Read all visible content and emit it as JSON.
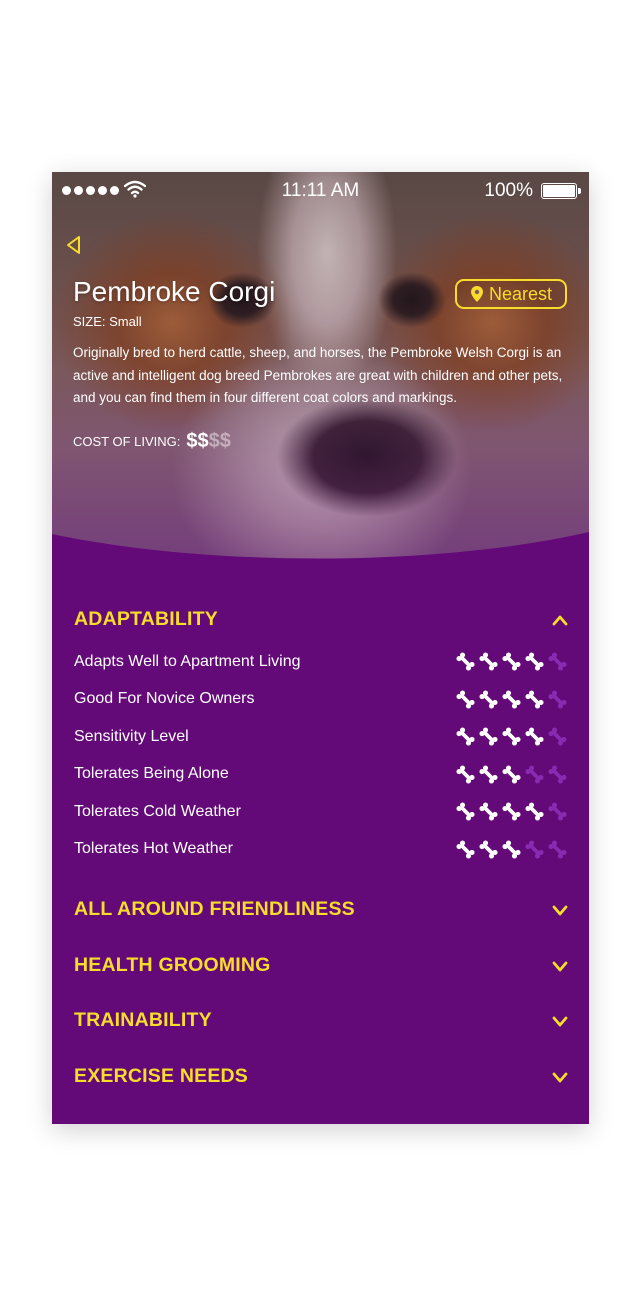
{
  "status": {
    "time": "11:11 AM",
    "battery": "100%"
  },
  "breed": {
    "name": "Pembroke Corgi",
    "size": "SIZE: Small",
    "description": "Originally bred to herd cattle, sheep, and horses, the Pembroke Welsh Corgi is an active and intelligent dog breed Pembrokes are great with children and other pets, and you can find them in four different coat colors and markings.",
    "cost_label": "COST OF LIVING:",
    "cost_level": 2,
    "cost_max": 4
  },
  "nearest_label": "Nearest",
  "colors": {
    "accent": "#f7dd2a",
    "background": "#630a78",
    "bone_on": "#ffffff",
    "bone_off": "#8a2ab0"
  },
  "sections": [
    {
      "title": "ADAPTABILITY",
      "expanded": true,
      "items": [
        {
          "label": "Adapts Well to Apartment Living",
          "rating": 4
        },
        {
          "label": "Good For Novice Owners",
          "rating": 4
        },
        {
          "label": "Sensitivity Level",
          "rating": 4
        },
        {
          "label": "Tolerates Being Alone",
          "rating": 3
        },
        {
          "label": "Tolerates Cold Weather",
          "rating": 4
        },
        {
          "label": "Tolerates Hot Weather",
          "rating": 3
        }
      ]
    },
    {
      "title": "ALL AROUND FRIENDLINESS",
      "expanded": false
    },
    {
      "title": "HEALTH GROOMING",
      "expanded": false
    },
    {
      "title": "TRAINABILITY",
      "expanded": false
    },
    {
      "title": "EXERCISE NEEDS",
      "expanded": false
    }
  ]
}
